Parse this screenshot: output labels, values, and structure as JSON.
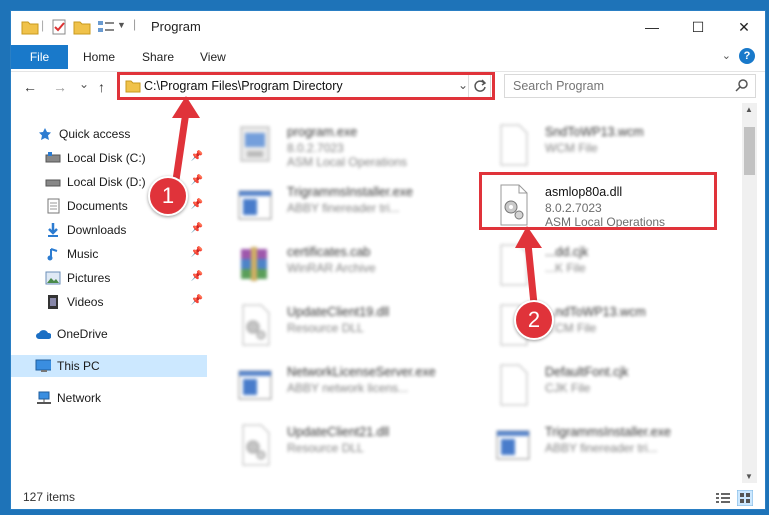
{
  "window": {
    "title": "Program",
    "minimize": "—",
    "maximize": "☐",
    "close": "✕"
  },
  "ribbon": {
    "tabs": [
      "File",
      "Home",
      "Share",
      "View"
    ],
    "help": "?"
  },
  "navigation": {
    "back": "←",
    "forward": "→",
    "recent": "⌄",
    "up": "↑",
    "address": "C:\\Program Files\\Program Directory",
    "search_placeholder": "Search Program"
  },
  "sidebar": {
    "items": [
      {
        "label": "Quick access",
        "icon": "star-icon"
      },
      {
        "label": "Local Disk (C:)",
        "icon": "drive-icon",
        "pinned": true
      },
      {
        "label": "Local Disk (D:)",
        "icon": "drive-icon",
        "pinned": true
      },
      {
        "label": "Documents",
        "icon": "documents-icon",
        "pinned": true
      },
      {
        "label": "Downloads",
        "icon": "downloads-icon",
        "pinned": true
      },
      {
        "label": "Music",
        "icon": "music-icon",
        "pinned": true
      },
      {
        "label": "Pictures",
        "icon": "pictures-icon",
        "pinned": true
      },
      {
        "label": "Videos",
        "icon": "videos-icon",
        "pinned": true
      },
      {
        "label": "OneDrive",
        "icon": "cloud-icon"
      },
      {
        "label": "This PC",
        "icon": "computer-icon",
        "selected": true
      },
      {
        "label": "Network",
        "icon": "network-icon"
      }
    ]
  },
  "files": {
    "left": [
      {
        "name": "program.exe",
        "line1": "8.0.2.7023",
        "line2": "ASM Local Operations",
        "icon": "installer-icon"
      },
      {
        "name": "TrigrammsInstaller.exe",
        "line1": "ABBY finereader tri...",
        "icon": "window-icon"
      },
      {
        "name": "certificates.cab",
        "line1": "WinRAR Archive",
        "icon": "archive-icon"
      },
      {
        "name": "UpdateClient19.dll",
        "line1": "Resource DLL",
        "icon": "gear-file-icon"
      },
      {
        "name": "NetworkLicenseServer.exe",
        "line1": "ABBY network licens...",
        "icon": "window-icon"
      },
      {
        "name": "UpdateClient21.dll",
        "line1": "Resource DLL",
        "icon": "gear-file-icon"
      }
    ],
    "right": [
      {
        "name": "SndToWP13.wcm",
        "line1": "WCM File",
        "icon": "blank-file-icon"
      },
      {
        "name": "asmlop80a.dll",
        "line1": "8.0.2.7023",
        "line2": "ASM Local Operations",
        "icon": "gear-file-icon",
        "highlight": true
      },
      {
        "name": "...dd.cjk",
        "line1": "...K File",
        "icon": "blank-file-icon"
      },
      {
        "name": "...ndToWP13.wcm",
        "line1": "...CM File",
        "icon": "blank-file-icon"
      },
      {
        "name": "DefaultFont.cjk",
        "line1": "CJK File",
        "icon": "blank-file-icon"
      },
      {
        "name": "TrigrammsInstaller.exe",
        "line1": "ABBY finereader tri...",
        "icon": "window-icon"
      }
    ]
  },
  "status": {
    "items": "127 items"
  },
  "annotations": {
    "step1": "1",
    "step2": "2",
    "color": "#e0333a"
  }
}
